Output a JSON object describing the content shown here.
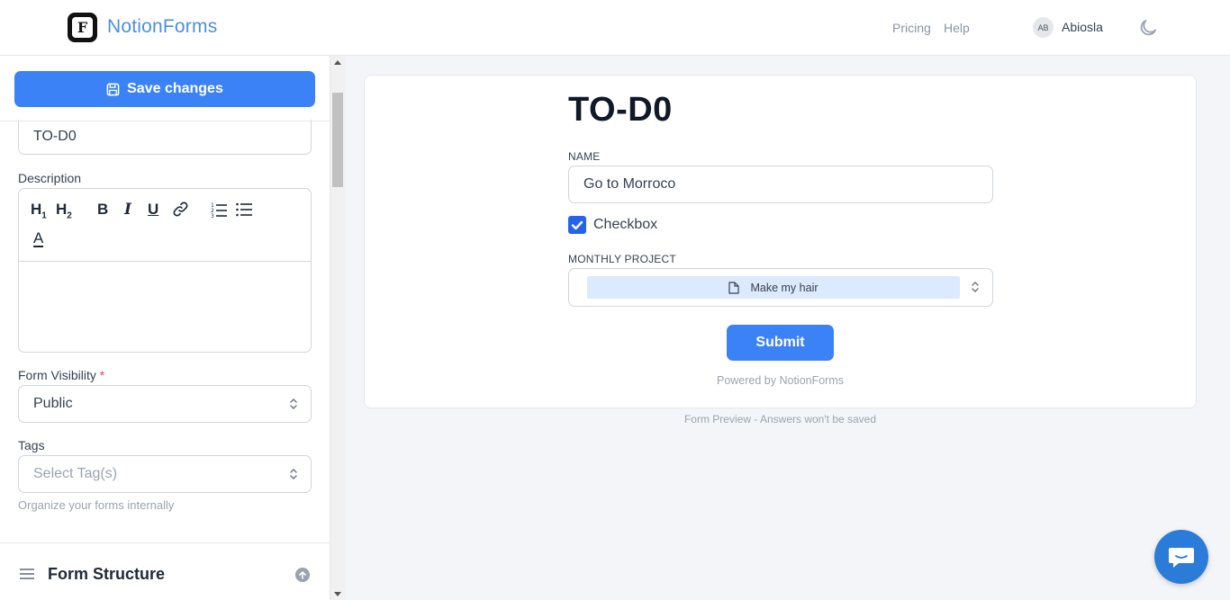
{
  "header": {
    "brand": "NotionForms",
    "logo_letter": "F",
    "nav": {
      "pricing": "Pricing",
      "help": "Help"
    },
    "user": {
      "initials": "AB",
      "name": "Abiosla"
    }
  },
  "sidebar": {
    "save_label": "Save changes",
    "form_title_value": "TO-D0",
    "description_label": "Description",
    "toolbar": {
      "h1": "H1",
      "h2": "H2",
      "bold": "B",
      "italic": "I",
      "underline": "U",
      "color": "A"
    },
    "visibility_label": "Form Visibility",
    "visibility_required": "*",
    "visibility_value": "Public",
    "tags_label": "Tags",
    "tags_placeholder": "Select Tag(s)",
    "tags_hint": "Organize your forms internally",
    "structure_title": "Form Structure"
  },
  "preview": {
    "title": "TO-D0",
    "name_label": "NAME",
    "name_value": "Go to Morroco",
    "checkbox_label": "Checkbox",
    "checkbox_checked": true,
    "project_label": "MONTHLY PROJECT",
    "project_value": "Make my hair",
    "submit_label": "Submit",
    "powered_by": "Powered by NotionForms",
    "note": "Form Preview - Answers won't be saved"
  },
  "colors": {
    "accent": "#3b82f6",
    "brand": "#4a90e2",
    "chip": "#dbeafe",
    "chat": "#2b7bd9"
  }
}
